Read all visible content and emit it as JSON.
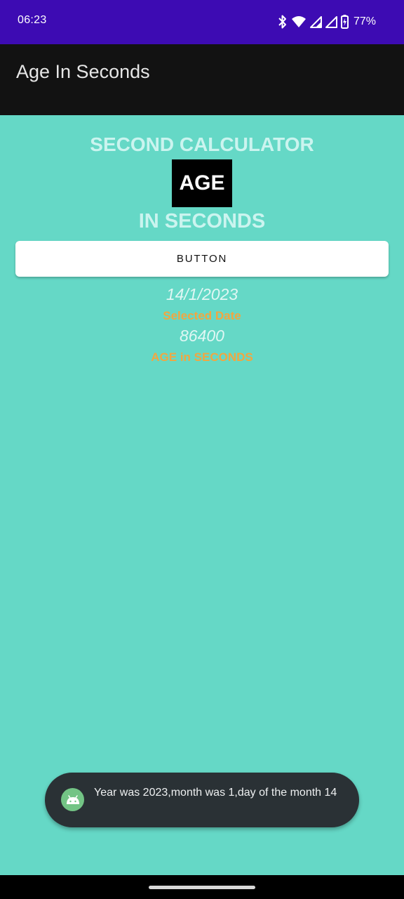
{
  "status_bar": {
    "time": "06:23",
    "battery_percent": "77%",
    "icons": [
      "bluetooth-icon",
      "wifi-icon",
      "signal-icon",
      "signal-icon",
      "battery-charging-icon"
    ]
  },
  "app_bar": {
    "title": "Age In Seconds"
  },
  "main": {
    "heading": "SECOND CALCULATOR",
    "age_box": "AGE",
    "subheading": "IN SECONDS",
    "button_label": "BUTTON",
    "selected_date_value": "14/1/2023",
    "selected_date_label": "Selected Date",
    "age_seconds_value": "86400",
    "age_seconds_label": "AGE in SECONDS"
  },
  "toast": {
    "message": "Year was 2023,month was 1,day of the month 14",
    "icon": "android-icon"
  },
  "colors": {
    "status_bar": "#3d0bb3",
    "app_bar": "#121212",
    "background": "#65d8c6",
    "heading_text": "#cbf4ef",
    "label_text": "#f2a640",
    "toast_bg": "#2a3135"
  }
}
